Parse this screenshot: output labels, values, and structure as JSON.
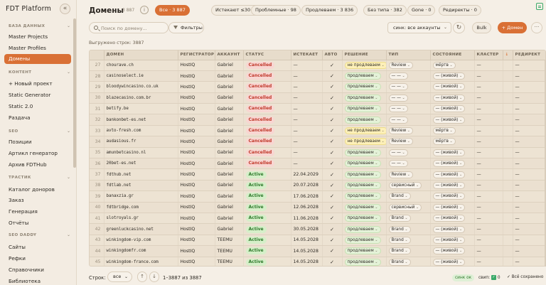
{
  "app": {
    "title": "FDT Platform",
    "collapse": "«"
  },
  "sidebar": {
    "sections": [
      {
        "title": "БАЗА ДАННЫХ",
        "items": [
          "Master Projects",
          "Master Profiles",
          "Домены"
        ]
      },
      {
        "title": "КОНТЕНТ",
        "items": [
          "+ Новый проект",
          "Static Generator",
          "Static 2.0",
          "Раздача"
        ]
      },
      {
        "title": "SEO",
        "items": [
          "Позиции",
          "Артикл генератор",
          "Архив FDTHub"
        ]
      },
      {
        "title": "ТРАСТИК",
        "items": [
          "Каталог доноров",
          "Заказ",
          "Генерация",
          "Отчёты"
        ]
      },
      {
        "title": "SEO DADDY",
        "items": [
          "Сайты",
          "Рефки",
          "Справочники",
          "Библиотека"
        ]
      }
    ],
    "active": "Домены"
  },
  "header": {
    "title": "Домены",
    "count": "3 887",
    "filters": [
      {
        "label": "Все · 3 887",
        "active": true
      },
      {
        "label": "Истекают ≤30 · 14"
      },
      {
        "label": "Проблемные · 98"
      },
      {
        "label": "Продлеваем · 3 836"
      },
      {
        "label": "Без типа · 382"
      },
      {
        "label": "Gone · 0"
      },
      {
        "label": "Редиректы · 0"
      }
    ]
  },
  "toolbar": {
    "search_placeholder": "Поиск по домену...",
    "filters_label": "Фильтры",
    "sync_select": "синк: все аккаунты",
    "bulk_label": "Bulk",
    "add_label": "+ Домен",
    "more_label": "···"
  },
  "loaded_text": "Выгружено строк: 3887",
  "table": {
    "columns": [
      "",
      "ДОМЕН",
      "РЕГИСТРАТОР",
      "АККАУНТ",
      "СТАТУС",
      "ИСТЕКАЕТ",
      "АВТО",
      "РЕШЕНИЕ",
      "ТИП",
      "СОСТОЯНИЕ",
      "КЛАСТЕР",
      "↓",
      "РЕДИРЕКТ"
    ],
    "rows": [
      {
        "n": "27",
        "domain": "chourave.ch",
        "reg": "HostIQ",
        "acc": "Gabriel",
        "status": "Cancelled",
        "exp": "—",
        "auto": "✓",
        "decision": "не продлеваем",
        "type": "Review",
        "state": "мёртв",
        "cluster": "—",
        "redirect": "—"
      },
      {
        "n": "28",
        "domain": "casinoselect.ie",
        "reg": "HostIQ",
        "acc": "Gabriel",
        "status": "Cancelled",
        "exp": "—",
        "auto": "✓",
        "decision": "продлеваем",
        "type": "— —",
        "state": "— (живой)",
        "cluster": "—",
        "redirect": "—"
      },
      {
        "n": "29",
        "domain": "bloodywincasino.co.uk",
        "reg": "HostIQ",
        "acc": "Gabriel",
        "status": "Cancelled",
        "exp": "—",
        "auto": "✓",
        "decision": "продлеваем",
        "type": "— —",
        "state": "— (живой)",
        "cluster": "—",
        "redirect": "—"
      },
      {
        "n": "30",
        "domain": "blazecasino.com.br",
        "reg": "HostIQ",
        "acc": "Gabriel",
        "status": "Cancelled",
        "exp": "—",
        "auto": "✓",
        "decision": "продлеваем",
        "type": "— —",
        "state": "— (живой)",
        "cluster": "—",
        "redirect": "—"
      },
      {
        "n": "31",
        "domain": "betify.be",
        "reg": "HostIQ",
        "acc": "Gabriel",
        "status": "Cancelled",
        "exp": "—",
        "auto": "✓",
        "decision": "продлеваем",
        "type": "— —",
        "state": "— (живой)",
        "cluster": "—",
        "redirect": "—"
      },
      {
        "n": "32",
        "domain": "bankonbet-es.net",
        "reg": "HostIQ",
        "acc": "Gabriel",
        "status": "Cancelled",
        "exp": "—",
        "auto": "✓",
        "decision": "продлеваем",
        "type": "— —",
        "state": "— (живой)",
        "cluster": "—",
        "redirect": "—"
      },
      {
        "n": "33",
        "domain": "avto-fresh.com",
        "reg": "HostIQ",
        "acc": "Gabriel",
        "status": "Cancelled",
        "exp": "—",
        "auto": "✓",
        "decision": "не продлеваем",
        "type": "Review",
        "state": "мёртв",
        "cluster": "—",
        "redirect": "—"
      },
      {
        "n": "34",
        "domain": "audasious.fr",
        "reg": "HostIQ",
        "acc": "Gabriel",
        "status": "Cancelled",
        "exp": "—",
        "auto": "✓",
        "decision": "не продлеваем",
        "type": "Review",
        "state": "мёртв",
        "cluster": "—",
        "redirect": "—"
      },
      {
        "n": "35",
        "domain": "amunbetcasino.nl",
        "reg": "HostIQ",
        "acc": "Gabriel",
        "status": "Cancelled",
        "exp": "—",
        "auto": "✓",
        "decision": "продлеваем",
        "type": "— —",
        "state": "— (живой)",
        "cluster": "—",
        "redirect": "—"
      },
      {
        "n": "36",
        "domain": "20bet-es.net",
        "reg": "HostIQ",
        "acc": "Gabriel",
        "status": "Cancelled",
        "exp": "—",
        "auto": "✓",
        "decision": "продлеваем",
        "type": "— —",
        "state": "— (живой)",
        "cluster": "—",
        "redirect": "—"
      },
      {
        "n": "37",
        "domain": "fdthub.net",
        "reg": "HostIQ",
        "acc": "Gabriel",
        "status": "Active",
        "exp": "22.04.2029",
        "auto": "✓",
        "decision": "продлеваем",
        "type": "Review",
        "state": "— (живой)",
        "cluster": "—",
        "redirect": "—"
      },
      {
        "n": "38",
        "domain": "fdtlab.net",
        "reg": "HostIQ",
        "acc": "Gabriel",
        "status": "Active",
        "exp": "20.07.2028",
        "auto": "✓",
        "decision": "продлеваем",
        "type": "сервисный",
        "state": "— (живой)",
        "cluster": "—",
        "redirect": "—"
      },
      {
        "n": "39",
        "domain": "banaxzia.gr",
        "reg": "HostIQ",
        "acc": "Gabriel",
        "status": "Active",
        "exp": "17.06.2028",
        "auto": "✓",
        "decision": "продлеваем",
        "type": "Brand",
        "state": "— (живой)",
        "cluster": "—",
        "redirect": "—"
      },
      {
        "n": "40",
        "domain": "fdtbridge.com",
        "reg": "HostIQ",
        "acc": "Gabriel",
        "status": "Active",
        "exp": "12.06.2028",
        "auto": "✓",
        "decision": "продлеваем",
        "type": "сервисный",
        "state": "— (живой)",
        "cluster": "—",
        "redirect": "—"
      },
      {
        "n": "41",
        "domain": "slotroyals.gr",
        "reg": "HostIQ",
        "acc": "Gabriel",
        "status": "Active",
        "exp": "11.06.2028",
        "auto": "✓",
        "decision": "продлеваем",
        "type": "Brand",
        "state": "— (живой)",
        "cluster": "—",
        "redirect": "—"
      },
      {
        "n": "42",
        "domain": "greenluckcasino.net",
        "reg": "HostIQ",
        "acc": "Gabriel",
        "status": "Active",
        "exp": "30.05.2028",
        "auto": "✓",
        "decision": "продлеваем",
        "type": "Brand",
        "state": "— (живой)",
        "cluster": "—",
        "redirect": "—"
      },
      {
        "n": "43",
        "domain": "winkingdom-vip.com",
        "reg": "HostIQ",
        "acc": "TEEMU",
        "status": "Active",
        "exp": "14.05.2028",
        "auto": "✓",
        "decision": "продлеваем",
        "type": "Brand",
        "state": "— (живой)",
        "cluster": "—",
        "redirect": "—"
      },
      {
        "n": "44",
        "domain": "winkingdomfr.com",
        "reg": "HostIQ",
        "acc": "TEEMU",
        "status": "Active",
        "exp": "14.05.2028",
        "auto": "✓",
        "decision": "продлеваем",
        "type": "Brand",
        "state": "— (живой)",
        "cluster": "—",
        "redirect": "—"
      },
      {
        "n": "45",
        "domain": "winkingdom-france.com",
        "reg": "HostIQ",
        "acc": "TEEMU",
        "status": "Active",
        "exp": "14.05.2028",
        "auto": "✓",
        "decision": "продлеваем",
        "type": "Brand",
        "state": "— (живой)",
        "cluster": "—",
        "redirect": "—"
      }
    ]
  },
  "footer": {
    "rows_label": "Строк:",
    "rows_select": "все",
    "page_up": "↑",
    "page_down": "↓",
    "range": "1–3887 из 3887",
    "sync_ok": "синк ок",
    "sync_label": "свип:",
    "sync_value": "0",
    "saved": "✓ Всё сохранено"
  },
  "colors": {
    "accent": "#d97035",
    "cancelled": "#c0392b",
    "active": "#2f7a2c"
  }
}
